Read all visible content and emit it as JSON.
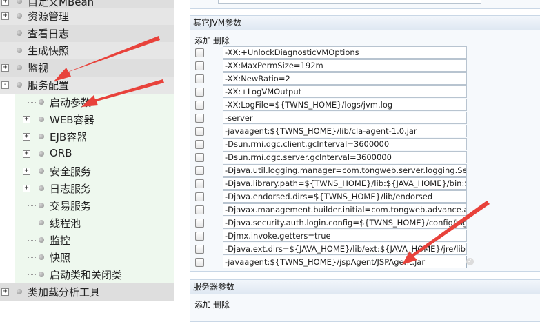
{
  "sidebar": {
    "top_items": [
      {
        "label": "自定义MBean",
        "toggle": "+"
      },
      {
        "label": "资源管理",
        "toggle": "+"
      },
      {
        "label": "查看日志",
        "toggle": ""
      },
      {
        "label": "生成快照",
        "toggle": ""
      },
      {
        "label": "监视",
        "toggle": "+"
      },
      {
        "label": "服务配置",
        "toggle": "-"
      }
    ],
    "sub_items": [
      {
        "label": "启动参数",
        "toggle": ""
      },
      {
        "label": "WEB容器",
        "toggle": "+"
      },
      {
        "label": "EJB容器",
        "toggle": "+"
      },
      {
        "label": "ORB",
        "toggle": "+"
      },
      {
        "label": "安全服务",
        "toggle": "+"
      },
      {
        "label": "日志服务",
        "toggle": "+"
      },
      {
        "label": "交易服务",
        "toggle": ""
      },
      {
        "label": "线程池",
        "toggle": ""
      },
      {
        "label": "监控",
        "toggle": ""
      },
      {
        "label": "快照",
        "toggle": ""
      },
      {
        "label": "启动类和关闭类",
        "toggle": ""
      }
    ],
    "bottom_item": {
      "label": "类加载分析工具",
      "toggle": "+"
    }
  },
  "jvm_panel": {
    "title": "其它JVM参数",
    "add_label": "添加",
    "delete_label": "删除",
    "params": [
      "-XX:+UnlockDiagnosticVMOptions",
      "-XX:MaxPermSize=192m",
      "-XX:NewRatio=2",
      "-XX:+LogVMOutput",
      "-XX:LogFile=${TWNS_HOME}/logs/jvm.log",
      "-server",
      "-javaagent:${TWNS_HOME}/lib/cla-agent-1.0.jar",
      "-Dsun.rmi.dgc.client.gcInterval=3600000",
      "-Dsun.rmi.dgc.server.gcInterval=3600000",
      "-Djava.util.logging.manager=com.tongweb.server.logging.Serve",
      "-Djava.library.path=${TWNS_HOME}/lib:${JAVA_HOME}/bin:${TW",
      "-Djava.endorsed.dirs=${TWNS_HOME}/lib/endorsed",
      "-Djavax.management.builder.initial=com.tongweb.advance.adm",
      "-Djava.security.auth.login.config=${TWNS_HOME}/config/login.c",
      "-Djmx.invoke.getters=true",
      "-Djava.ext.dirs=${JAVA_HOME}/lib/ext:${JAVA_HOME}/jre/lib/ext:$",
      "-javaagent:${TWNS_HOME}/jspAgent/JSPAgent.jar"
    ]
  },
  "server_panel": {
    "title": "服务器参数",
    "add_label": "添加",
    "delete_label": "删除"
  },
  "colors": {
    "arrow": "#e8423b",
    "sidebar_sub_bg": "#eef8ee",
    "sidebar_top_bg": "#dedede"
  }
}
